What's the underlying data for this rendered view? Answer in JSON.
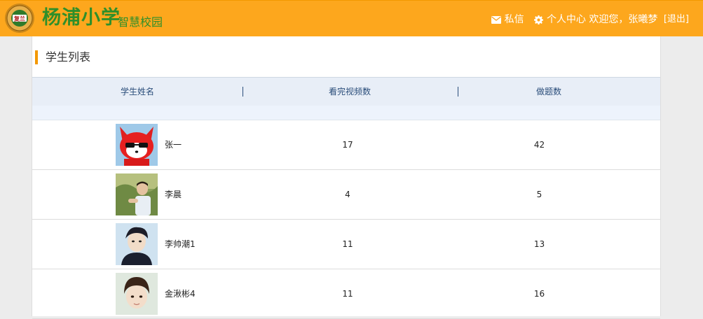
{
  "header": {
    "logo_text": "复兰",
    "brand": "杨浦小学",
    "brand_sub": "智慧校园",
    "messages_label": "私信",
    "profile_label": "个人中心",
    "welcome": "欢迎您，张曦梦",
    "logout": "[退出]"
  },
  "section": {
    "title": "学生列表"
  },
  "table": {
    "columns": [
      "学生姓名",
      "看完视频数",
      "做题数"
    ],
    "rows": [
      {
        "name": "张一",
        "videos": "17",
        "questions": "42",
        "avatar": "cartoon-fox-avatar"
      },
      {
        "name": "李晨",
        "videos": "4",
        "questions": "5",
        "avatar": "boy-photo-avatar"
      },
      {
        "name": "李帅潮1",
        "videos": "11",
        "questions": "13",
        "avatar": "boy-photo-avatar"
      },
      {
        "name": "金湫彬4",
        "videos": "11",
        "questions": "16",
        "avatar": "boy-photo-avatar"
      }
    ]
  },
  "colors": {
    "header_bg": "#fda71d",
    "brand_green": "#2f8f2a",
    "accent_orange": "#f39800",
    "table_header_bg": "#e8eef7",
    "table_header_text": "#2a4d7a"
  }
}
